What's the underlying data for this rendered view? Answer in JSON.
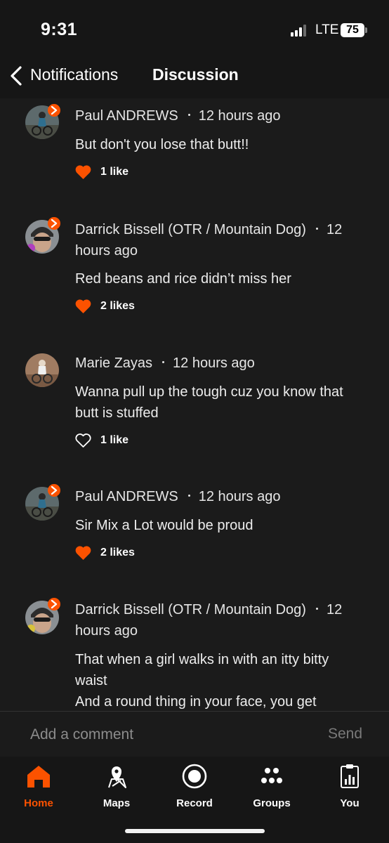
{
  "status_bar": {
    "time": "9:31",
    "network": "LTE",
    "battery": "75"
  },
  "nav": {
    "back_label": "Notifications",
    "title": "Discussion"
  },
  "comments": [
    {
      "author": "Paul ANDREWS",
      "time": "12 hours ago",
      "text": "But don't you lose that butt!!",
      "likes": "1 like",
      "liked": true,
      "avatar": "cyclist-avatar"
    },
    {
      "author": "Darrick Bissell (OTR / Mountain Dog)",
      "time": "12 hours ago",
      "text": "Red beans and rice didn’t miss her",
      "likes": "2 likes",
      "liked": true,
      "avatar": "helmet-selfie-avatar"
    },
    {
      "author": "Marie Zayas",
      "time": "12 hours ago",
      "text": "Wanna pull up the tough cuz you know that butt is stuffed",
      "likes": "1 like",
      "liked": false,
      "avatar": "desert-cyclist-avatar"
    },
    {
      "author": "Paul ANDREWS",
      "time": "12 hours ago",
      "text": "Sir Mix a Lot would be proud",
      "likes": "2 likes",
      "liked": true,
      "avatar": "cyclist-avatar"
    },
    {
      "author": "Darrick Bissell (OTR / Mountain Dog)",
      "time": "12 hours ago",
      "text": "That when a girl walks in with an itty bitty waist\nAnd a round thing in your face, you get",
      "likes": "",
      "liked": false,
      "avatar": "helmet-selfie-avatar"
    }
  ],
  "composer": {
    "placeholder": "Add a comment",
    "send_label": "Send"
  },
  "tabs": [
    {
      "label": "Home",
      "icon": "home-icon",
      "active": true
    },
    {
      "label": "Maps",
      "icon": "map-pin-icon",
      "active": false
    },
    {
      "label": "Record",
      "icon": "record-icon",
      "active": false
    },
    {
      "label": "Groups",
      "icon": "groups-icon",
      "active": false
    },
    {
      "label": "You",
      "icon": "profile-clipboard-icon",
      "active": false
    }
  ],
  "colors": {
    "accent": "#fc5200",
    "background": "#1b1b1b",
    "header": "#161616",
    "text": "#ededed",
    "muted": "#8c8c8c"
  }
}
